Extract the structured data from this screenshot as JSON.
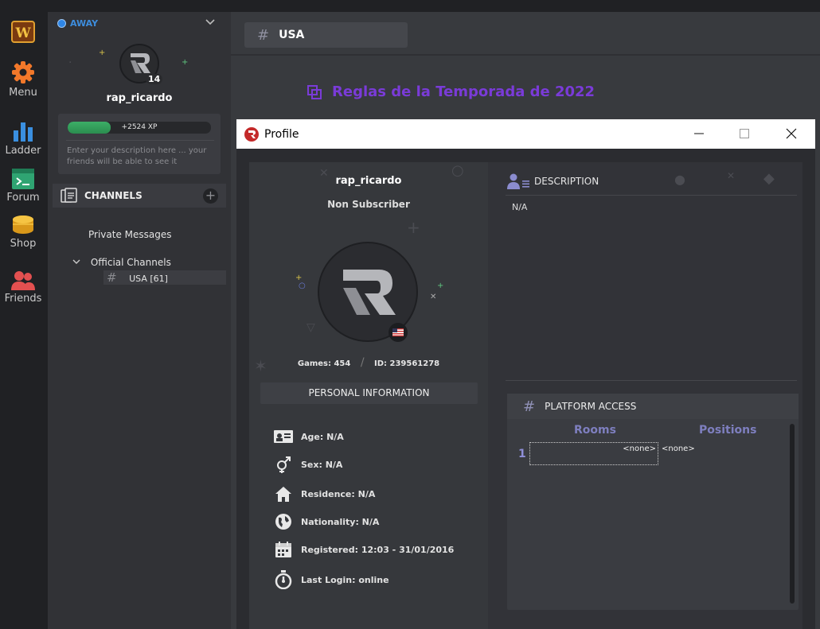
{
  "rail": {
    "menu": "Menu",
    "ladder": "Ladder",
    "forum": "Forum",
    "shop": "Shop",
    "friends": "Friends"
  },
  "sidebar": {
    "status": "AWAY",
    "level": "14",
    "username": "rap_ricardo",
    "xp_text": "+2524 XP",
    "xp_fraction": 0.3,
    "description_placeholder": "Enter your description here ... your friends will be able to see it",
    "channels_title": "CHANNELS",
    "private_messages": "Private Messages",
    "official_channels": "Official Channels",
    "usa_channel": "USA [61]"
  },
  "main": {
    "tab_title": "USA",
    "rules_title": "Reglas de la Temporada de 2022"
  },
  "profile": {
    "window_title": "Profile",
    "name": "rap_ricardo",
    "subscription": "Non Subscriber",
    "games": "Games: 454",
    "id": "ID: 239561278",
    "stats_sep": "/",
    "personal_info_title": "PERSONAL INFORMATION",
    "age": "Age: N/A",
    "sex": "Sex: N/A",
    "residence": "Residence: N/A",
    "nationality": "Nationality: N/A",
    "registered": "Registered: 12:03 - 31/01/2016",
    "last_login": "Last Login: online",
    "description_title": "DESCRIPTION",
    "description_text": "N/A",
    "platform_title": "PLATFORM ACCESS",
    "col_rooms": "Rooms",
    "col_positions": "Positions",
    "row_num": "1",
    "room_value": "<none>",
    "position_value": "<none>"
  },
  "colors": {
    "accent_purple": "#7a3bd8",
    "status_blue": "#2f86e6",
    "xp_green": "#3cae67"
  }
}
